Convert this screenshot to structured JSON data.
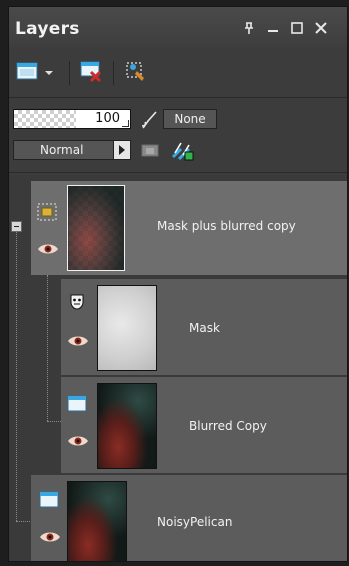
{
  "panel": {
    "title": "Layers",
    "title_buttons": [
      "pin-icon",
      "minimize-icon",
      "maximize-icon",
      "close-icon"
    ]
  },
  "toolbar": {
    "icons": [
      "new-layer-icon",
      "dropdown-arrow-icon",
      "delete-layer-icon",
      "edit-selection-icon"
    ]
  },
  "properties": {
    "opacity_value": "100",
    "brush_variance": "None",
    "blend_mode": "Normal"
  },
  "layers": [
    {
      "name": "Mask plus blurred copy",
      "type": "group",
      "selected": true,
      "visible": true
    },
    {
      "name": "Mask",
      "type": "mask",
      "selected": false,
      "visible": true
    },
    {
      "name": "Blurred Copy",
      "type": "raster",
      "selected": false,
      "visible": true
    },
    {
      "name": "NoisyPelican",
      "type": "raster",
      "selected": false,
      "visible": true
    }
  ],
  "colors": {
    "panel_bg": "#3c3c3c",
    "selected_row": "#6e6e6e",
    "row_bg": "#5c5c5c",
    "accent_blue": "#3aa7e0",
    "delete_red": "#d02a2a"
  }
}
